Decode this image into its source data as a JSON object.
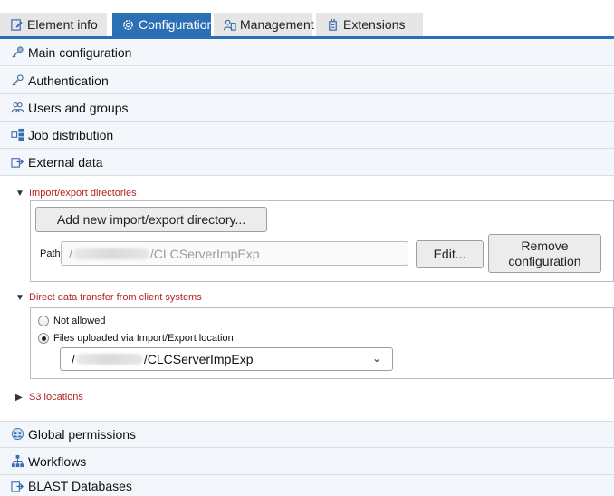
{
  "tabs": [
    {
      "label": "Element info",
      "icon": "edit-icon",
      "active": false
    },
    {
      "label": "Configuration",
      "icon": "gear-icon",
      "active": true
    },
    {
      "label": "Management",
      "icon": "users-icon",
      "active": false
    },
    {
      "label": "Extensions",
      "icon": "plugin-icon",
      "active": false
    }
  ],
  "sections_top": [
    {
      "label": "Main configuration",
      "icon": "key-icon"
    },
    {
      "label": "Authentication",
      "icon": "key-icon"
    },
    {
      "label": "Users and groups",
      "icon": "users-icon"
    },
    {
      "label": "Job distribution",
      "icon": "servers-icon"
    },
    {
      "label": "External data",
      "icon": "export-icon"
    }
  ],
  "import_export": {
    "heading": "Import/export directories",
    "add_button": "Add new import/export directory...",
    "path_label": "Path",
    "path_prefix": "/",
    "path_suffix": "/CLCServerImpExp",
    "edit_button": "Edit...",
    "remove_button_line1": "Remove",
    "remove_button_line2": "configuration"
  },
  "direct_transfer": {
    "heading": "Direct data transfer from client systems",
    "options": [
      {
        "label": "Not allowed",
        "selected": false
      },
      {
        "label": "Files uploaded via Import/Export location",
        "selected": true
      }
    ],
    "select_prefix": "/",
    "select_suffix": "/CLCServerImpExp"
  },
  "s3": {
    "heading": "S3 locations"
  },
  "sections_bottom": [
    {
      "label": "Global permissions",
      "icon": "permissions-icon"
    },
    {
      "label": "Workflows",
      "icon": "workflow-icon"
    },
    {
      "label": "BLAST Databases",
      "icon": "database-icon"
    }
  ],
  "colors": {
    "accent": "#2b6fb5",
    "section_bg": "#f3f6fb",
    "group_heading": "#b22222"
  }
}
